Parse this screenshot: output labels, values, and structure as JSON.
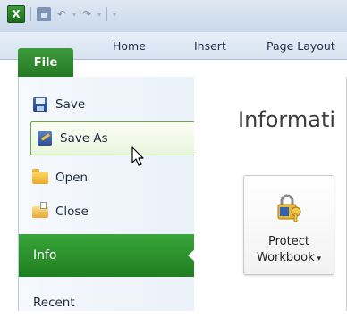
{
  "title_bar": {
    "app_icon_letter": "X",
    "quick_access": [
      "save-icon",
      "undo-icon",
      "redo-icon",
      "customize-icon"
    ]
  },
  "ribbon": {
    "file_tab": "File",
    "tabs": [
      "Home",
      "Insert",
      "Page Layout"
    ]
  },
  "backstage_nav": {
    "items": [
      {
        "label": "Save",
        "icon": "save-icon"
      },
      {
        "label": "Save As",
        "icon": "save-as-icon"
      },
      {
        "label": "Open",
        "icon": "open-folder-icon"
      },
      {
        "label": "Close",
        "icon": "close-folder-icon"
      },
      {
        "label": "Info"
      },
      {
        "label": "Recent"
      }
    ],
    "selected": "Info",
    "hovered": "Save As"
  },
  "main": {
    "title": "Informati",
    "protect_button": {
      "line1": "Protect",
      "line2": "Workbook"
    }
  },
  "colors": {
    "accent_green": "#247a22",
    "ribbon_blue": "#d7e3f1"
  }
}
